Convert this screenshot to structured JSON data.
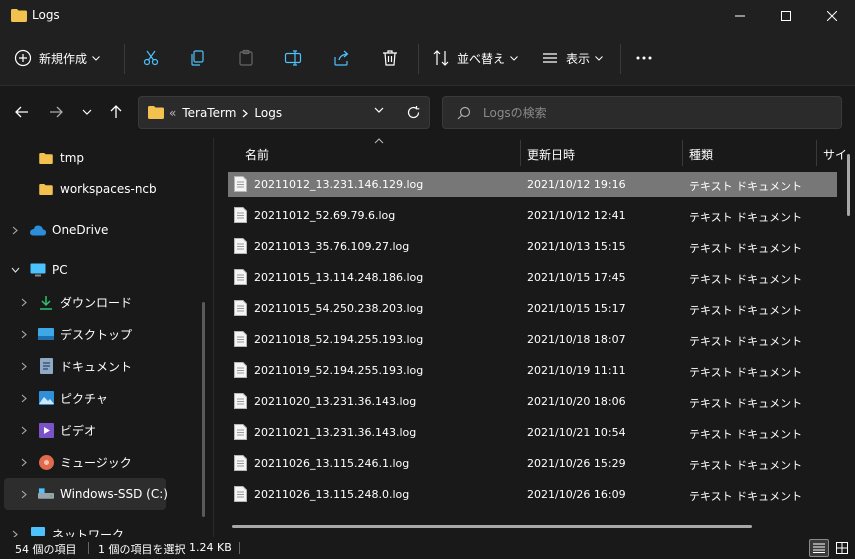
{
  "window": {
    "title": "Logs"
  },
  "toolbar": {
    "new_label": "新規作成",
    "sort_label": "並べ替え",
    "view_label": "表示"
  },
  "address": {
    "crumbs": [
      "TeraTerm",
      "Logs"
    ]
  },
  "search": {
    "placeholder": "Logsの検索"
  },
  "sidebar": {
    "items": [
      {
        "label": "tmp",
        "icon": "folder-icon"
      },
      {
        "label": "workspaces-ncb",
        "icon": "folder-icon"
      },
      {
        "label": "OneDrive",
        "icon": "cloud-icon"
      },
      {
        "label": "PC",
        "icon": "monitor-icon"
      },
      {
        "label": "ダウンロード",
        "icon": "download-icon"
      },
      {
        "label": "デスクトップ",
        "icon": "desktop-icon"
      },
      {
        "label": "ドキュメント",
        "icon": "document-icon"
      },
      {
        "label": "ピクチャ",
        "icon": "pictures-icon"
      },
      {
        "label": "ビデオ",
        "icon": "video-icon"
      },
      {
        "label": "ミュージック",
        "icon": "music-icon"
      },
      {
        "label": "Windows-SSD (C:)",
        "icon": "drive-icon"
      },
      {
        "label": "ネットワーク",
        "icon": "network-icon"
      }
    ]
  },
  "columns": {
    "name": "名前",
    "date": "更新日時",
    "type": "種類",
    "size": "サイ"
  },
  "files": [
    {
      "name": "20211012_13.231.146.129.log",
      "date": "2021/10/12 19:16",
      "type": "テキスト ドキュメント"
    },
    {
      "name": "20211012_52.69.79.6.log",
      "date": "2021/10/12 12:41",
      "type": "テキスト ドキュメント"
    },
    {
      "name": "20211013_35.76.109.27.log",
      "date": "2021/10/13 15:15",
      "type": "テキスト ドキュメント"
    },
    {
      "name": "20211015_13.114.248.186.log",
      "date": "2021/10/15 17:45",
      "type": "テキスト ドキュメント"
    },
    {
      "name": "20211015_54.250.238.203.log",
      "date": "2021/10/15 15:17",
      "type": "テキスト ドキュメント"
    },
    {
      "name": "20211018_52.194.255.193.log",
      "date": "2021/10/18 18:07",
      "type": "テキスト ドキュメント"
    },
    {
      "name": "20211019_52.194.255.193.log",
      "date": "2021/10/19 11:11",
      "type": "テキスト ドキュメント"
    },
    {
      "name": "20211020_13.231.36.143.log",
      "date": "2021/10/20 18:06",
      "type": "テキスト ドキュメント"
    },
    {
      "name": "20211021_13.231.36.143.log",
      "date": "2021/10/21 10:54",
      "type": "テキスト ドキュメント"
    },
    {
      "name": "20211026_13.115.246.1.log",
      "date": "2021/10/26 15:29",
      "type": "テキスト ドキュメント"
    },
    {
      "name": "20211026_13.115.248.0.log",
      "date": "2021/10/26 16:09",
      "type": "テキスト ドキュメント"
    }
  ],
  "status": {
    "item_count": "54 個の項目",
    "selection": "1 個の項目を選択",
    "size": "1.24 KB"
  },
  "colors": {
    "background": "#191919",
    "bar": "#202020",
    "selected_row": "#777777",
    "folder": "#f2c14e",
    "accent": "#4cc2ff"
  }
}
